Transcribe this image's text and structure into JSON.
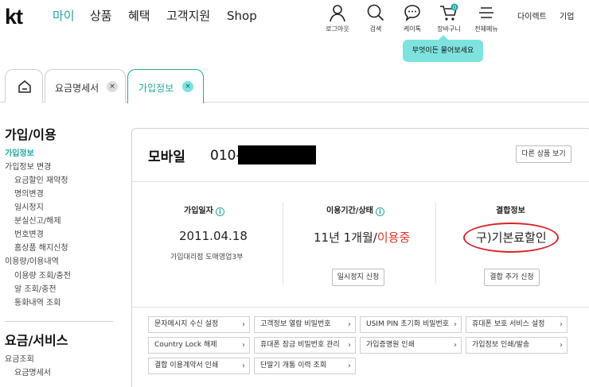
{
  "header": {
    "logo": "kt",
    "nav": [
      "마이",
      "상품",
      "혜택",
      "고객지원",
      "Shop"
    ],
    "util": [
      {
        "label": "로그아웃",
        "icon": "person-icon"
      },
      {
        "label": "검색",
        "icon": "search-icon"
      },
      {
        "label": "케이톡",
        "icon": "chat-icon"
      },
      {
        "label": "장바구니",
        "icon": "cart-icon",
        "badge": "0"
      },
      {
        "label": "전체메뉴",
        "icon": "menu-icon"
      }
    ],
    "top_links": [
      "다이렉트",
      "기업"
    ],
    "tooltip": "무엇이든 물어보세요"
  },
  "tabs": {
    "bill": "요금명세서",
    "join": "가입정보",
    "close": "×"
  },
  "sidebar": {
    "section1_title": "가입/이용",
    "items1": [
      "가입정보",
      "가입정보 변경",
      "요금할인 재약정",
      "명의변경",
      "일시정지",
      "분실신고/해제",
      "번호변경",
      "홈상품 해지신청",
      "이용량/이용내역",
      "이용량 조회/충전",
      "알 조회/충전",
      "통화내역 조회"
    ],
    "section2_title": "요금/서비스",
    "items2": [
      "요금조회",
      "요금명세서"
    ]
  },
  "main": {
    "product": "모바일",
    "phone_prefix": "010-",
    "other_button": "다른 상품 보기",
    "join_date_head": "가입일자",
    "join_date": "2011.04.18",
    "join_store": "가입대리점 도매영업3부",
    "period_head": "이용기간/상태",
    "period": "11년 1개월/",
    "status": "이용중",
    "suspend_button": "일시정지 신청",
    "combine_head": "결합정보",
    "combine_value": "구)기본료할인",
    "combine_button": "결합 추가 신청",
    "info": "i",
    "links": [
      "문자메시지 수신 설정",
      "고객정보 열람 비밀번호",
      "USIM PIN 초기화 비밀번호",
      "휴대폰 보호 서비스 설정",
      "Country Lock 해제",
      "휴대폰 잠금 비밀번호 관리",
      "가입증명원 인쇄",
      "가입정보 인쇄/발송",
      "결합 이용계약서 인쇄",
      "단말기 개통 이력 조회"
    ],
    "link_arrow": "›"
  },
  "colors": {
    "accent": "#1fa8a1",
    "status_red": "#e0392c",
    "tooltip_bg": "#7ee3df",
    "annotation_circle": "#d8232a"
  }
}
